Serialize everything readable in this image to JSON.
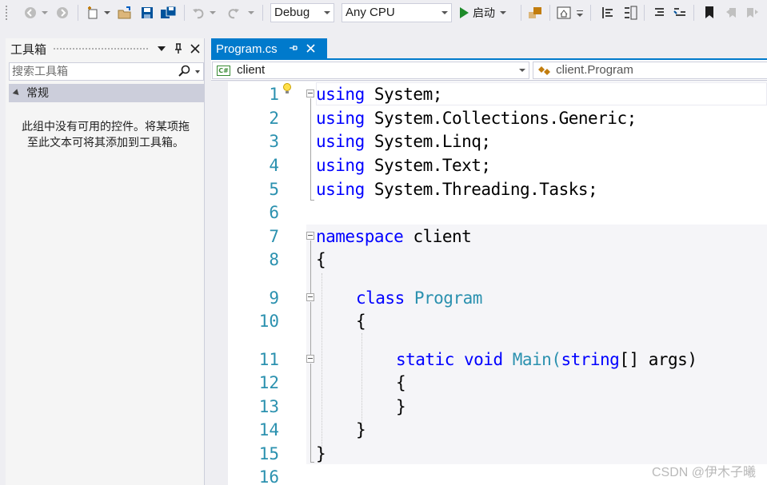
{
  "toolbar": {
    "config_combo": "Debug",
    "platform_combo": "Any CPU",
    "run_label": "启动"
  },
  "toolbox": {
    "title": "工具箱",
    "search_placeholder": "搜索工具箱",
    "group_label": "常规",
    "empty_message": "此组中没有可用的控件。将某项拖至此文本可将其添加到工具箱。"
  },
  "editor": {
    "tab_label": "Program.cs",
    "nav_project": "client",
    "nav_type": "client.Program",
    "line_numbers": [
      "1",
      "2",
      "3",
      "4",
      "5",
      "6",
      "7",
      "8",
      "9",
      "10",
      "11",
      "12",
      "13",
      "14",
      "15",
      "16"
    ],
    "lines": [
      {
        "k": "using",
        "t": " System;"
      },
      {
        "k": "using",
        "t": " System.Collections.Generic;"
      },
      {
        "k": "using",
        "t": " System.Linq;"
      },
      {
        "k": "using",
        "t": " System.Text;"
      },
      {
        "k": "using",
        "t": " System.Threading.Tasks;"
      },
      {
        "k": "namespace",
        "t": " client"
      },
      {
        "t": "{"
      },
      {
        "k": "class",
        "ty": "Program"
      },
      {
        "t": "{"
      },
      {
        "k": "static",
        "k2": "void",
        "t": "Main(",
        "k3": "string",
        "t2": "[] args)"
      },
      {
        "t": "{"
      },
      {
        "t": "}"
      },
      {
        "t": "}"
      },
      {
        "t": "}"
      }
    ]
  },
  "watermark": "CSDN @伊木子曦"
}
